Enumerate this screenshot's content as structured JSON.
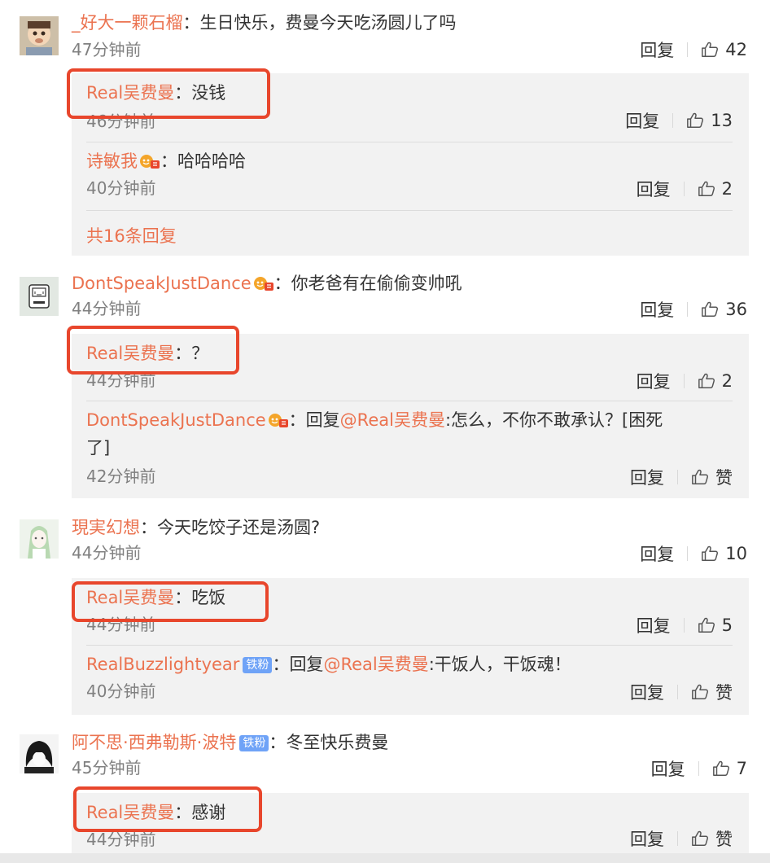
{
  "colors": {
    "username": "#eb7350",
    "highlight": "#e8462c",
    "reply_bg": "#f2f2f2",
    "time": "#808080"
  },
  "comments": [
    {
      "user": "_好大一颗石榴",
      "text": "生日快乐，费曼今天吃汤圆儿了吗",
      "time": "47分钟前",
      "reply": "回复",
      "likes": "42",
      "replies": [
        {
          "user": "Real吴费曼",
          "text": "没钱",
          "time": "46分钟前",
          "reply": "回复",
          "likes": "13"
        },
        {
          "user": "诗敏我",
          "text": "哈哈哈哈",
          "time": "40分钟前",
          "reply": "回复",
          "likes": "2"
        }
      ],
      "more": "共16条回复"
    },
    {
      "user": "DontSpeakJustDance",
      "text": "你老爸有在偷偷变帅吼",
      "time": "44分钟前",
      "reply": "回复",
      "likes": "36",
      "replies": [
        {
          "user": "Real吴费曼",
          "text": "？",
          "time": "44分钟前",
          "reply": "回复",
          "likes": "2"
        },
        {
          "user": "DontSpeakJustDance",
          "text_prefix": "回复",
          "mention": "@Real吴费曼",
          "text": ":怎么，不你不敢承认？[困死",
          "text2": "了]",
          "time": "42分钟前",
          "reply": "回复",
          "likes": "赞"
        }
      ]
    },
    {
      "user": "現実幻想",
      "text": "今天吃饺子还是汤圆?",
      "time": "44分钟前",
      "reply": "回复",
      "likes": "10",
      "replies": [
        {
          "user": "Real吴费曼",
          "text": "吃饭",
          "time": "44分钟前",
          "reply": "回复",
          "likes": "5"
        },
        {
          "user": "RealBuzzlightyear",
          "badge": "铁粉",
          "text_prefix": "回复",
          "mention": "@Real吴费曼",
          "text": ":干饭人，干饭魂！",
          "time": "40分钟前",
          "reply": "回复",
          "likes": "赞"
        }
      ]
    },
    {
      "user": "阿不思·西弗勒斯·波特",
      "badge": "铁粉",
      "text": "冬至快乐费曼",
      "time": "45分钟前",
      "reply": "回复",
      "likes": "7",
      "replies": [
        {
          "user": "Real吴费曼",
          "text": "感谢",
          "time": "44分钟前",
          "reply": "回复",
          "likes": "赞"
        }
      ]
    }
  ]
}
